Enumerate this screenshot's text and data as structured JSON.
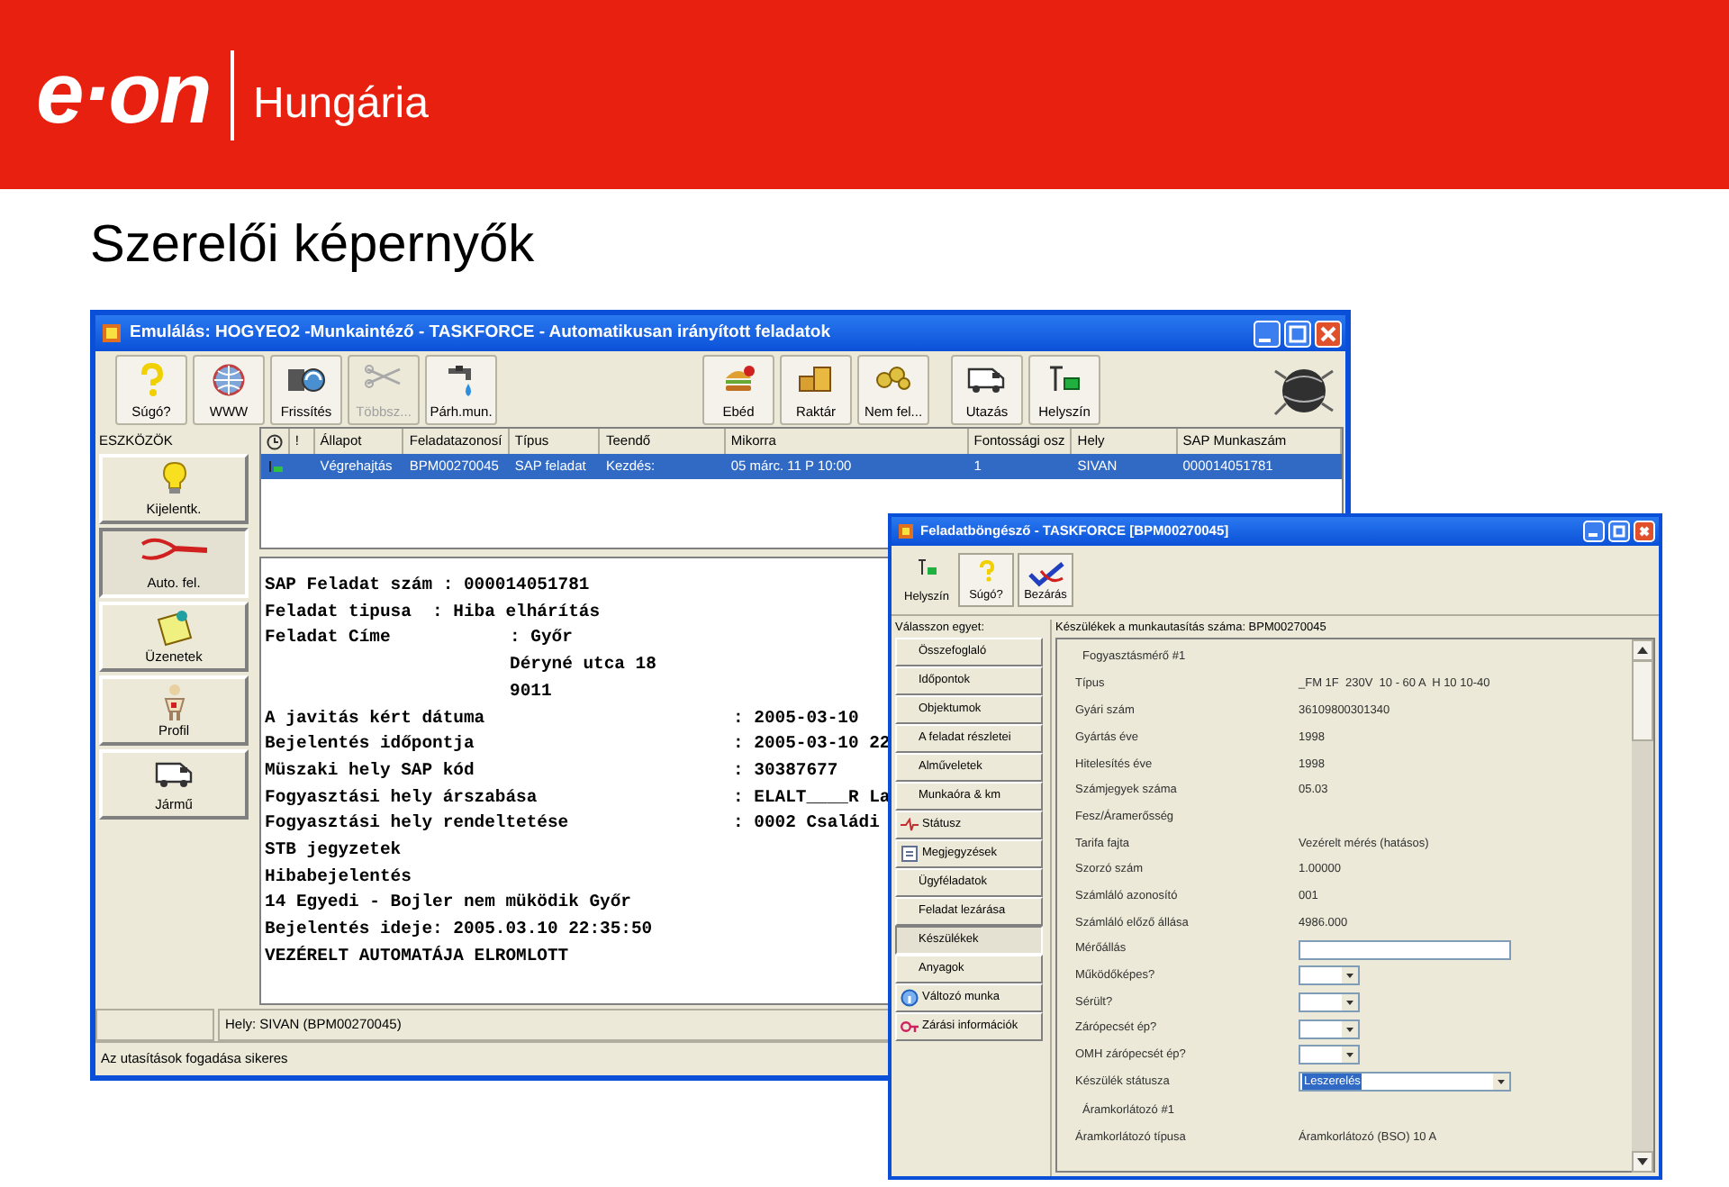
{
  "header": {
    "logo": "e·on",
    "region": "Hungária"
  },
  "slide_title": "Szerelői képernyők",
  "main_window": {
    "title": "Emulálás: HOGYEO2 -Munkaintéző - TASKFORCE - Automatikusan irányított feladatok",
    "toolbar_groups": [
      [
        {
          "label": "Súgó?",
          "disabled": false
        },
        {
          "label": "WWW",
          "disabled": false
        },
        {
          "label": "Frissítés",
          "disabled": false
        },
        {
          "label": "Többsz...",
          "disabled": true
        },
        {
          "label": "Párh.mun.",
          "disabled": false
        }
      ],
      [
        {
          "label": "Ebéd",
          "disabled": false
        },
        {
          "label": "Raktár",
          "disabled": false
        },
        {
          "label": "Nem fel...",
          "disabled": false
        }
      ],
      [
        {
          "label": "Utazás",
          "disabled": false
        },
        {
          "label": "Helyszín",
          "disabled": false
        }
      ]
    ],
    "tools": {
      "title": "ESZKÖZÖK",
      "items": [
        {
          "label": "Kijelentk.",
          "selected": false
        },
        {
          "label": "Auto. fel.",
          "selected": true
        },
        {
          "label": "Üzenetek",
          "selected": false
        },
        {
          "label": "Profil",
          "selected": false
        },
        {
          "label": "Jármű",
          "selected": false
        }
      ]
    },
    "columns": [
      "!",
      "Állapot",
      "Feladatazonosí",
      "Típus",
      "Teendő",
      "Mikorra",
      "Fontossági osz",
      "Hely",
      "SAP Munkaszám"
    ],
    "rows": [
      {
        "selected": true,
        "cells": [
          "",
          "Végrehajtás",
          "BPM00270045",
          "SAP feladat",
          "Kezdés:",
          "05 márc. 11 P 10:00",
          "1",
          "SIVAN",
          "000014051781"
        ]
      }
    ],
    "detail_lines": [
      {
        "kind": "text",
        "label": "SAP Feladat szám : 000014051781"
      },
      {
        "kind": "text",
        "label": "Feladat tipusa  : Hiba elhárítás"
      },
      {
        "kind": "mid",
        "label": "Feladat Címe",
        "value": ": Győr"
      },
      {
        "kind": "mid",
        "value": "Déryné utca 18"
      },
      {
        "kind": "mid",
        "value": "9011"
      },
      {
        "kind": "far",
        "label": "A javitás kért dátuma",
        "value": ": 2005-03-10"
      },
      {
        "kind": "far",
        "label": "Bejelentés időpontja",
        "value": ": 2005-03-10 22"
      },
      {
        "kind": "far",
        "label": "Müszaki hely SAP kód",
        "value": ": 30387677"
      },
      {
        "kind": "far",
        "label": "Fogyasztási hely árszabása",
        "value": ": ELALT____R La"
      },
      {
        "kind": "far",
        "label": "Fogyasztási hely rendeltetése",
        "value": ": 0002 Családi"
      },
      {
        "kind": "text",
        "label": "STB jegyzetek"
      },
      {
        "kind": "text",
        "label": "Hibabejelentés"
      },
      {
        "kind": "text",
        "label": "14 Egyedi - Bojler nem müködik Győr"
      },
      {
        "kind": "text",
        "label": "Bejelentés ideje: 2005.03.10 22:35:50"
      },
      {
        "kind": "text",
        "label": "VEZÉRELT AUTOMATÁJA ELROMLOTT"
      }
    ],
    "status_location": "Hely: SIVAN (BPM00270045)",
    "status_message": "Az utasítások fogadása sikeres"
  },
  "dialog": {
    "title": "Feladatböngésző - TASKFORCE [BPM00270045]",
    "toolbar": [
      {
        "label": "Helyszín"
      },
      {
        "label": "Súgó?"
      },
      {
        "label": "Bezárás"
      }
    ],
    "nav_title": "Válasszon egyet:",
    "nav": [
      {
        "label": "Összefoglaló",
        "selected": false
      },
      {
        "label": "Időpontok",
        "selected": false
      },
      {
        "label": "Objektumok",
        "selected": false
      },
      {
        "label": "A feladat részletei",
        "selected": false
      },
      {
        "label": "Alműveletek",
        "selected": false
      },
      {
        "label": "Munkaóra & km",
        "selected": false
      },
      {
        "label": "Státusz",
        "selected": false
      },
      {
        "label": "Megjegyzések",
        "selected": false
      },
      {
        "label": "Ügyféladatok",
        "selected": false
      },
      {
        "label": "Feladat lezárása",
        "selected": false
      },
      {
        "label": "Készülékek",
        "selected": true
      },
      {
        "label": "Anyagok",
        "selected": false
      },
      {
        "label": "Változó munka",
        "selected": false
      },
      {
        "label": "Zárási információk",
        "selected": false
      }
    ],
    "panel_caption": "Készülékek a munkautasítás száma: BPM00270045",
    "rows": [
      {
        "kind": "heading",
        "label": "Fogyasztásmérő #1"
      },
      {
        "kind": "value",
        "label": "Típus",
        "value": "_FM 1F  230V  10 - 60 A  H 10 10-40"
      },
      {
        "kind": "value",
        "label": "Gyári szám",
        "value": "36109800301340"
      },
      {
        "kind": "value",
        "label": "Gyártás éve",
        "value": "1998"
      },
      {
        "kind": "value",
        "label": "Hitelesítés éve",
        "value": "1998"
      },
      {
        "kind": "value",
        "label": "Számjegyek száma",
        "value": "05.03"
      },
      {
        "kind": "value",
        "label": "Fesz/Áramerősség"
      },
      {
        "kind": "value",
        "label": "Tarifa fajta",
        "value": "Vezérelt mérés (hatásos)"
      },
      {
        "kind": "value",
        "label": "Szorzó szám",
        "value": "1.00000"
      },
      {
        "kind": "value",
        "label": "Számláló azonosító",
        "value": "001"
      },
      {
        "kind": "value",
        "label": "Számláló előző állása",
        "value": "4986.000"
      },
      {
        "kind": "entry",
        "label": "Mérőállás"
      },
      {
        "kind": "combo",
        "label": "Működőképes?"
      },
      {
        "kind": "combo",
        "label": "Sérült?"
      },
      {
        "kind": "combo",
        "label": "Zárópecsét ép?"
      },
      {
        "kind": "combo",
        "label": "OMH zárópecsét ép?"
      },
      {
        "kind": "widecombo",
        "label": "Készülék státusza",
        "value": "Leszerelés"
      },
      {
        "kind": "heading",
        "label": "Áramkorlátozó #1"
      },
      {
        "kind": "value",
        "label": "Áramkorlátozó típusa",
        "value": "Áramkorlátozó (BSO) 10 A"
      }
    ]
  }
}
